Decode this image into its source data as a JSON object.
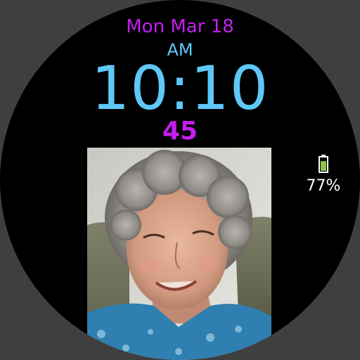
{
  "watch": {
    "date": "Mon Mar 18",
    "ampm": "AM",
    "time": "10:10",
    "seconds": "45"
  },
  "battery": {
    "percent_text": "77%",
    "level": 0.77,
    "icon": "battery-icon"
  },
  "photo": {
    "subject": "portrait-photo"
  },
  "colors": {
    "accent_magenta": "#c61df0",
    "time_blue": "#5ec8f8",
    "battery_green": "#8bc34a",
    "background": "#000000"
  }
}
